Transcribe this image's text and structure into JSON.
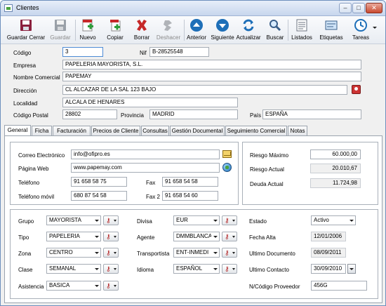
{
  "window": {
    "title": "Clientes"
  },
  "toolbar": {
    "save_close": "Guardar Cerrar",
    "save": "Guardar",
    "new": "Nuevo",
    "copy": "Copiar",
    "delete": "Borrar",
    "undo": "Deshacer",
    "previous": "Anterior",
    "next": "Siguiente",
    "refresh": "Actualizar",
    "search": "Buscar",
    "listings": "Listados",
    "labels": "Etiquetas",
    "tasks": "Tareas"
  },
  "header": {
    "codigo_label": "Código",
    "codigo_value": "3",
    "nif_label": "Nif",
    "nif_value": "B-28525548",
    "empresa_label": "Empresa",
    "empresa_value": "PAPELERIA MAYORISTA, S.L.",
    "nombre_comercial_label": "Nombre Comercial",
    "nombre_comercial_value": "PAPEMAY",
    "direccion_label": "Dirección",
    "direccion_value": "CL ALCAZAR DE LA SAL 123 BAJO",
    "localidad_label": "Localidad",
    "localidad_value": "ALCALA DE HENARES",
    "cp_label": "Código Postal",
    "cp_value": "28802",
    "provincia_label": "Provincia",
    "provincia_value": "MADRID",
    "pais_label": "País",
    "pais_value": "ESPAÑA"
  },
  "tabs": [
    "General",
    "Ficha",
    "Facturación",
    "Precios de Cliente",
    "Consultas",
    "Gestión Documental",
    "Seguimiento Comercial",
    "Notas"
  ],
  "contact": {
    "email_label": "Correo Electrónico",
    "email_value": "info@ofipro.es",
    "web_label": "Página Web",
    "web_value": "www.papemay.com",
    "tel_label": "Teléfono",
    "tel_value": "91 658 58 75",
    "fax_label": "Fax",
    "fax_value": "91 658 54 58",
    "mobile_label": "Teléfono móvil",
    "mobile_value": "680 87 54 58",
    "fax2_label": "Fax 2",
    "fax2_value": "91 658 54 60"
  },
  "risk": {
    "max_label": "Riesgo Máximo",
    "max_value": "60.000,00",
    "current_label": "Riesgo Actual",
    "current_value": "20.010,67",
    "debt_label": "Deuda Actual",
    "debt_value": "11.724,98"
  },
  "classification": {
    "grupo_label": "Grupo",
    "grupo_value": "MAYORISTA",
    "tipo_label": "Tipo",
    "tipo_value": "PAPELERIA",
    "zona_label": "Zona",
    "zona_value": "CENTRO",
    "clase_label": "Clase",
    "clase_value": "SEMANAL",
    "asistencia_label": "Asistencia",
    "asistencia_value": "BASICA",
    "divisa_label": "Divisa",
    "divisa_value": "EUR",
    "agente_label": "Agente",
    "agente_value": "DMMBLANCA",
    "transportista_label": "Transportista",
    "transportista_value": "ENT-INMEDI",
    "idioma_label": "Idioma",
    "idioma_value": "ESPAÑOL",
    "estado_label": "Estado",
    "estado_value": "Activo",
    "fecha_alta_label": "Fecha Alta",
    "fecha_alta_value": "12/01/2006",
    "ultimo_doc_label": "Ultimo Documento",
    "ultimo_doc_value": "08/09/2011",
    "ultimo_contacto_label": "Ultimo Contacto",
    "ultimo_contacto_value": "30/09/2010",
    "cod_proveedor_label": "N/Código Proveedor",
    "cod_proveedor_value": "456G"
  },
  "colors": {
    "accent_blue": "#1e6fb8",
    "delete_red": "#c62828",
    "window_border": "#6d8fbd"
  }
}
